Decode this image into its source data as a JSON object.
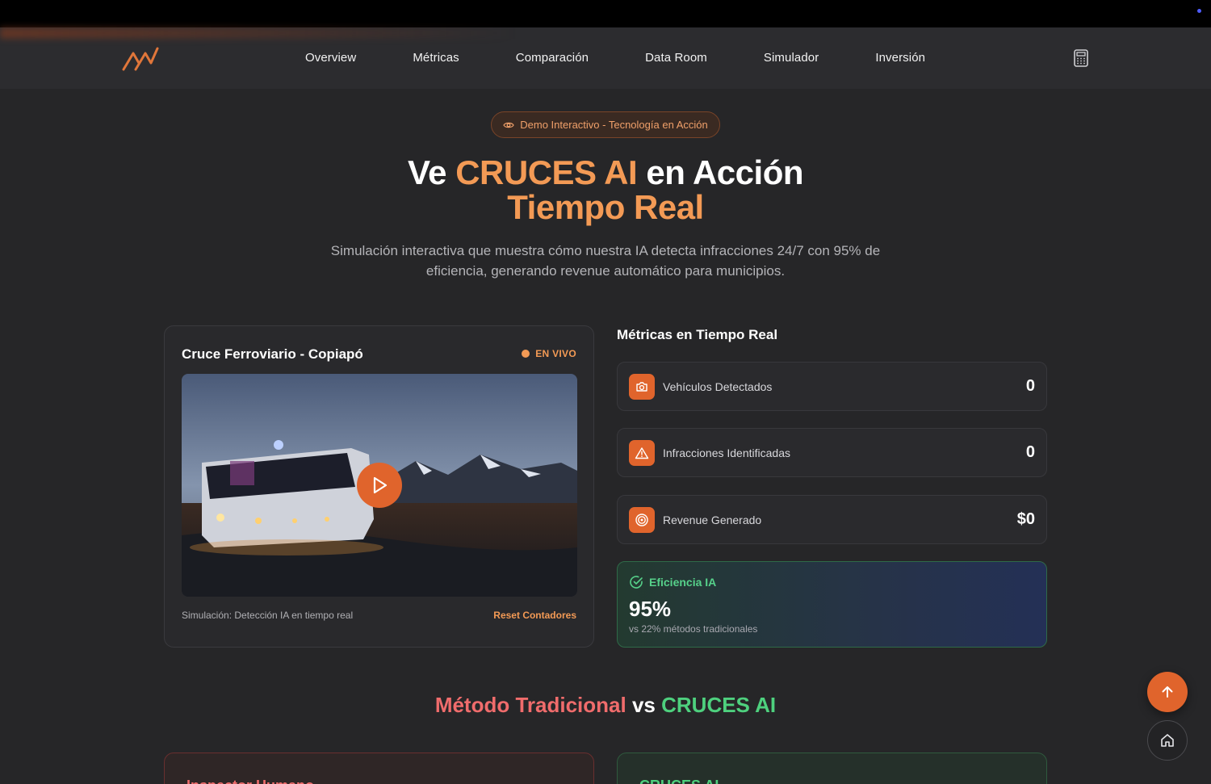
{
  "nav": {
    "items": [
      "Overview",
      "Métricas",
      "Comparación",
      "Data Room",
      "Simulador",
      "Inversión"
    ],
    "logo_icon": "brand-logo-icon",
    "calculator_icon": "calculator-icon"
  },
  "hero": {
    "badge": "Demo Interactivo - Tecnología en Acción",
    "title_pre": "Ve ",
    "title_brand": "CRUCES AI",
    "title_post": " en Acción",
    "title_line2": "Tiempo Real",
    "subtitle": "Simulación interactiva que muestra cómo nuestra IA detecta infracciones 24/7 con 95% de eficiencia, generando revenue automático para municipios."
  },
  "video_card": {
    "title": "Cruce Ferroviario - Copiapó",
    "live_label": "EN VIVO",
    "caption": "Simulación: Detección IA en tiempo real",
    "reset_label": "Reset Contadores"
  },
  "metrics": {
    "title": "Métricas en Tiempo Real",
    "items": [
      {
        "label": "Vehículos Detectados",
        "value": "0",
        "icon": "camera-icon"
      },
      {
        "label": "Infracciones Identificadas",
        "value": "0",
        "icon": "warning-icon"
      },
      {
        "label": "Revenue Generado",
        "value": "$0",
        "icon": "target-icon"
      }
    ],
    "efficiency": {
      "title": "Eficiencia IA",
      "value": "95%",
      "subtitle": "vs 22% métodos tradicionales"
    }
  },
  "comparison": {
    "left": "Método Tradicional",
    "mid": " vs ",
    "right": "CRUCES AI",
    "left_card": "Inspector Humano",
    "right_card": "CRUCES AI"
  },
  "colors": {
    "accent": "#e0642c",
    "accent_light": "#f39a55",
    "green": "#4ed07e",
    "red": "#f06c6c",
    "background": "#262628"
  }
}
